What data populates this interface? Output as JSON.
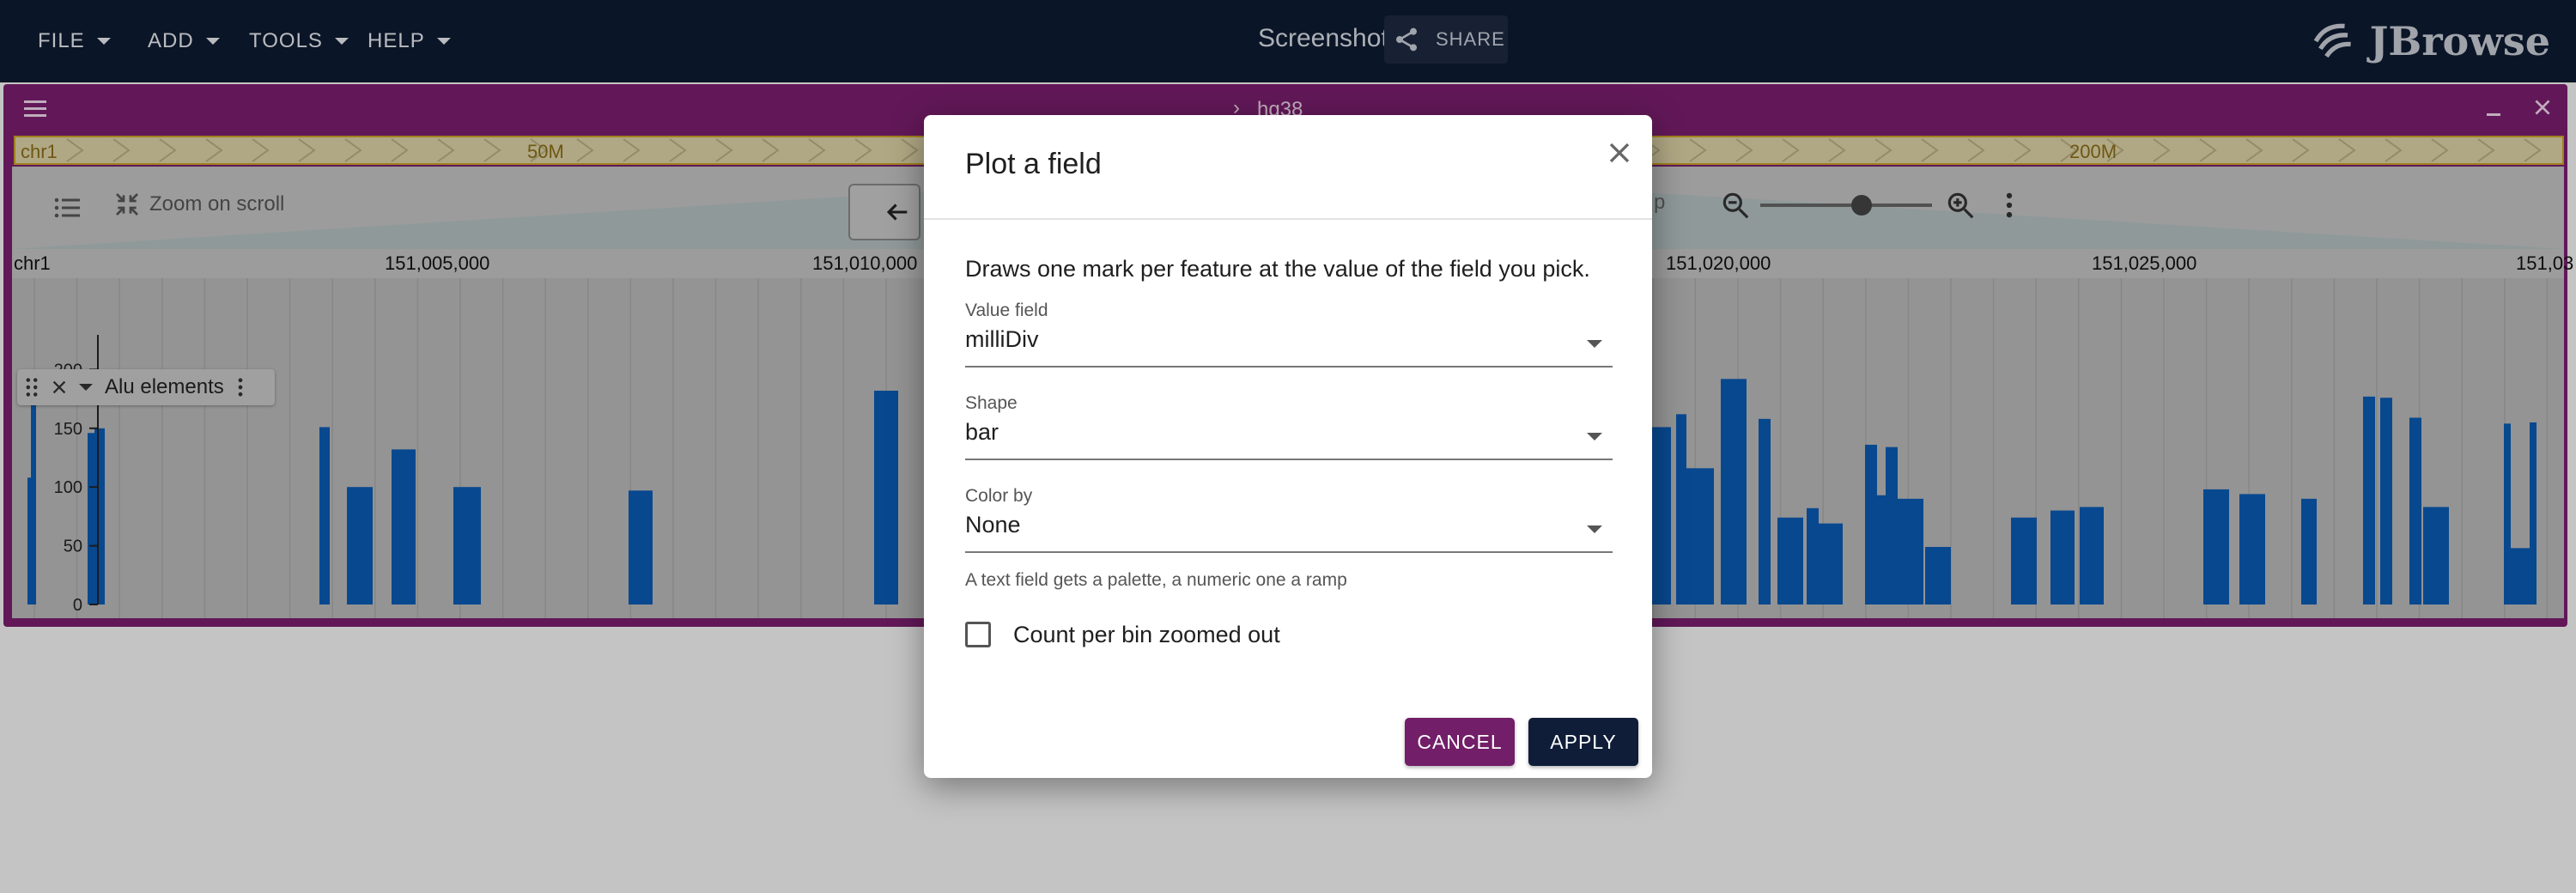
{
  "menubar": {
    "items": [
      "FILE",
      "ADD",
      "TOOLS",
      "HELP"
    ]
  },
  "session": {
    "title": "Screenshot",
    "share_label": "SHARE"
  },
  "logo": {
    "text": "JBrowse"
  },
  "view": {
    "assembly": "hg38",
    "overview_labels": [
      "chr1",
      "50M",
      "200M"
    ],
    "zoom_on_scroll_label": "Zoom on scroll",
    "bp_fragment": "p",
    "scale_labels": [
      "chr1",
      "151,005,000",
      "151,010,000",
      "151,020,000",
      "151,025,000",
      "151,03"
    ]
  },
  "track": {
    "name": "Alu elements",
    "y_ticks": [
      "200",
      "150",
      "100",
      "50",
      "0"
    ]
  },
  "colors": {
    "accent": "#7b1f6e",
    "bar": "#0b5bb3",
    "topbar": "#0d1b31",
    "apply": "#0f1d38",
    "cancel": "#721e68"
  },
  "dialog": {
    "title": "Plot a field",
    "description": "Draws one mark per feature at the value of the field you pick.",
    "fields": [
      {
        "label": "Value field",
        "value": "milliDiv"
      },
      {
        "label": "Shape",
        "value": "bar"
      },
      {
        "label": "Color by",
        "value": "None"
      }
    ],
    "helper": "A text field gets a palette, a numeric one a ramp",
    "checkbox_label": "Count per bin zoomed out",
    "checkbox_checked": false,
    "cancel_label": "CANCEL",
    "apply_label": "APPLY"
  }
}
